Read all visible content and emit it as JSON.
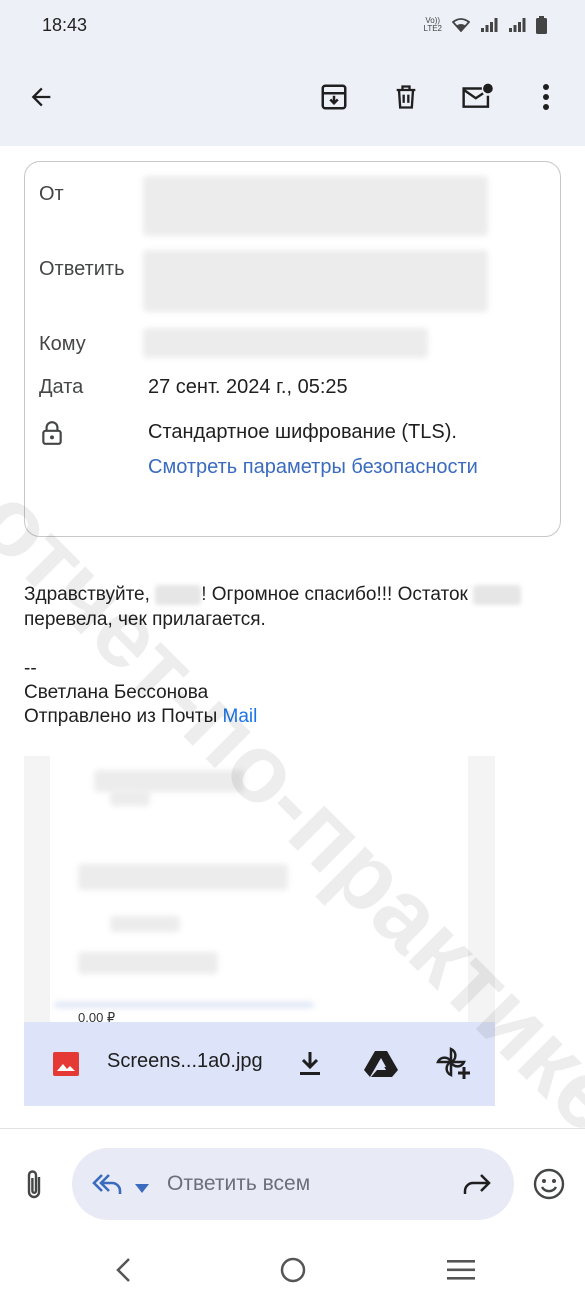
{
  "status_bar": {
    "time": "18:43",
    "network_label_top": "Vo))",
    "network_label_bottom": "LTE2",
    "icons": [
      "wifi-icon",
      "signal-icon",
      "signal-icon",
      "battery-icon"
    ]
  },
  "toolbar": {
    "back_icon": "arrow-left-icon",
    "archive_icon": "archive-icon",
    "delete_icon": "trash-icon",
    "mark_unread_icon": "mail-unread-icon",
    "more_icon": "more-vertical-icon"
  },
  "header": {
    "from_label": "От",
    "reply_to_label": "Ответить",
    "to_label": "Кому",
    "date_label": "Дата",
    "date_value": "27 сент. 2024 г., 05:25",
    "encryption_text": "Стандартное шифрование (TLS).",
    "security_link": "Смотреть параметры безопасности"
  },
  "message": {
    "greeting": "Здравствуйте,",
    "sentence_part": "! Огромное спасибо!!! Остаток",
    "line2": "перевела, чек прилагается.",
    "signature_dash": "--",
    "signature_name": "Светлана Бессонова",
    "sent_from": "Отправлено из Почты",
    "sent_from_link": "Mail"
  },
  "attachment": {
    "preview_amount": "0,00 ₽",
    "filename": "Screens...1a0.jpg",
    "download_icon": "download-icon",
    "drive_icon": "google-drive-icon",
    "photos_icon": "google-photos-add-icon"
  },
  "reply": {
    "placeholder": "Ответить всем",
    "attach_icon": "paperclip-icon",
    "reply_all_icon": "reply-all-icon",
    "forward_icon": "forward-icon",
    "emoji_icon": "emoji-icon"
  },
  "watermark": "отчет-по-практике.рф",
  "colors": {
    "header_bg": "#eef0f8",
    "link": "#3a6bbf",
    "attachment_bar": "#dde3f8",
    "image_icon": "#e53935"
  }
}
